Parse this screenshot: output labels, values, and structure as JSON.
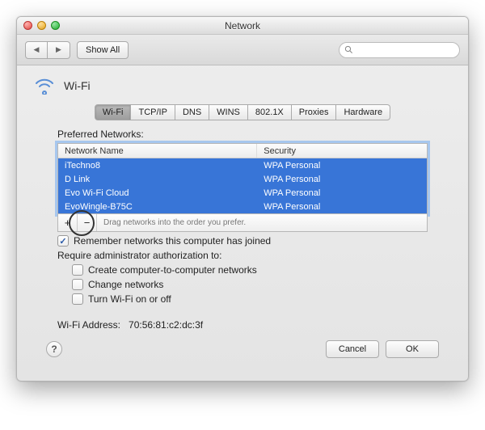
{
  "window": {
    "title": "Network"
  },
  "toolbar": {
    "show_all": "Show All",
    "search_placeholder": ""
  },
  "header": {
    "title": "Wi-Fi"
  },
  "tabs": [
    "Wi-Fi",
    "TCP/IP",
    "DNS",
    "WINS",
    "802.1X",
    "Proxies",
    "Hardware"
  ],
  "section": {
    "preferred_label": "Preferred Networks:",
    "columns": {
      "name": "Network Name",
      "security": "Security"
    },
    "networks": [
      {
        "name": "iTechno8",
        "security": "WPA Personal"
      },
      {
        "name": "D Link",
        "security": "WPA Personal"
      },
      {
        "name": "Evo Wi-Fi Cloud",
        "security": "WPA Personal"
      },
      {
        "name": "EvoWingle-B75C",
        "security": "WPA Personal"
      }
    ],
    "drag_hint": "Drag networks into the order you prefer.",
    "remember_label": "Remember networks this computer has joined",
    "require_label": "Require administrator authorization to:",
    "opts": {
      "create": "Create computer-to-computer networks",
      "change": "Change networks",
      "toggle": "Turn Wi-Fi on or off"
    },
    "addr_label": "Wi-Fi Address:",
    "addr_value": "70:56:81:c2:dc:3f"
  },
  "footer": {
    "cancel": "Cancel",
    "ok": "OK"
  }
}
